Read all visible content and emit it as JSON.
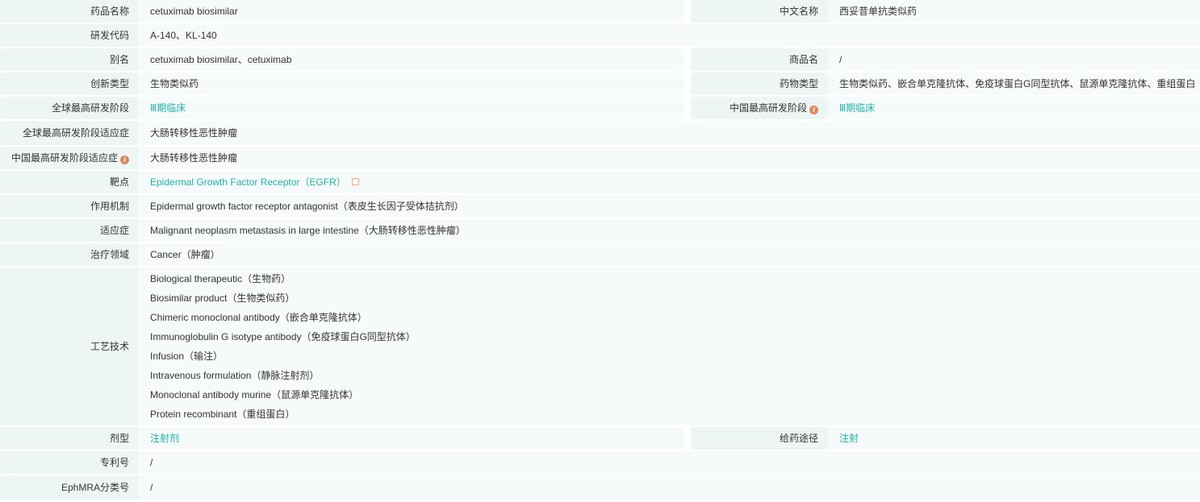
{
  "rows": {
    "drug_name": {
      "label": "药品名称",
      "value": "cetuximab biosimilar"
    },
    "chinese_name": {
      "label": "中文名称",
      "value": "西妥昔单抗类似药"
    },
    "rd_code": {
      "label": "研发代码",
      "value": "A-140、KL-140"
    },
    "alias": {
      "label": "别名",
      "value": "cetuximab biosimilar、cetuximab"
    },
    "trade_name": {
      "label": "商品名",
      "value": "/"
    },
    "innovation_type": {
      "label": "创新类型",
      "value": "生物类似药"
    },
    "drug_type": {
      "label": "药物类型",
      "value": "生物类似药、嵌合单克隆抗体、免疫球蛋白G同型抗体、鼠源单克隆抗体、重组蛋白"
    },
    "global_phase": {
      "label": "全球最高研发阶段",
      "value": "Ⅲ期临床"
    },
    "china_phase": {
      "label": "中国最高研发阶段",
      "value": "Ⅲ期临床"
    },
    "global_indication": {
      "label": "全球最高研发阶段适应症",
      "value": "大肠转移性恶性肿瘤"
    },
    "china_indication": {
      "label": "中国最高研发阶段适应症",
      "value": "大肠转移性恶性肿瘤"
    },
    "target": {
      "label": "靶点",
      "value": "Epidermal Growth Factor Receptor（EGFR）"
    },
    "mechanism": {
      "label": "作用机制",
      "value": "Epidermal growth factor receptor antagonist（表皮生长因子受体拮抗剂）"
    },
    "indication": {
      "label": "适应症",
      "value": "Malignant neoplasm metastasis in large intestine（大肠转移性恶性肿瘤）"
    },
    "therapeutic_area": {
      "label": "治疗领域",
      "value": "Cancer（肿瘤）"
    },
    "technology": {
      "label": "工艺技术",
      "values": [
        "Biological therapeutic（生物药）",
        "Biosimilar product（生物类似药）",
        "Chimeric monoclonal antibody（嵌合单克隆抗体）",
        "Immunoglobulin G isotype antibody（免疫球蛋白G同型抗体）",
        "Infusion（输注）",
        "Intravenous formulation（静脉注射剂）",
        "Monoclonal antibody murine（鼠源单克隆抗体）",
        "Protein recombinant（重组蛋白）"
      ]
    },
    "dosage_form": {
      "label": "剂型",
      "value": "注射剂"
    },
    "route": {
      "label": "给药途径",
      "value": "注射"
    },
    "patent": {
      "label": "专利号",
      "value": "/"
    },
    "ephmra": {
      "label": "EphMRA分类号",
      "value": "/"
    }
  },
  "icons": {
    "info": "i"
  }
}
